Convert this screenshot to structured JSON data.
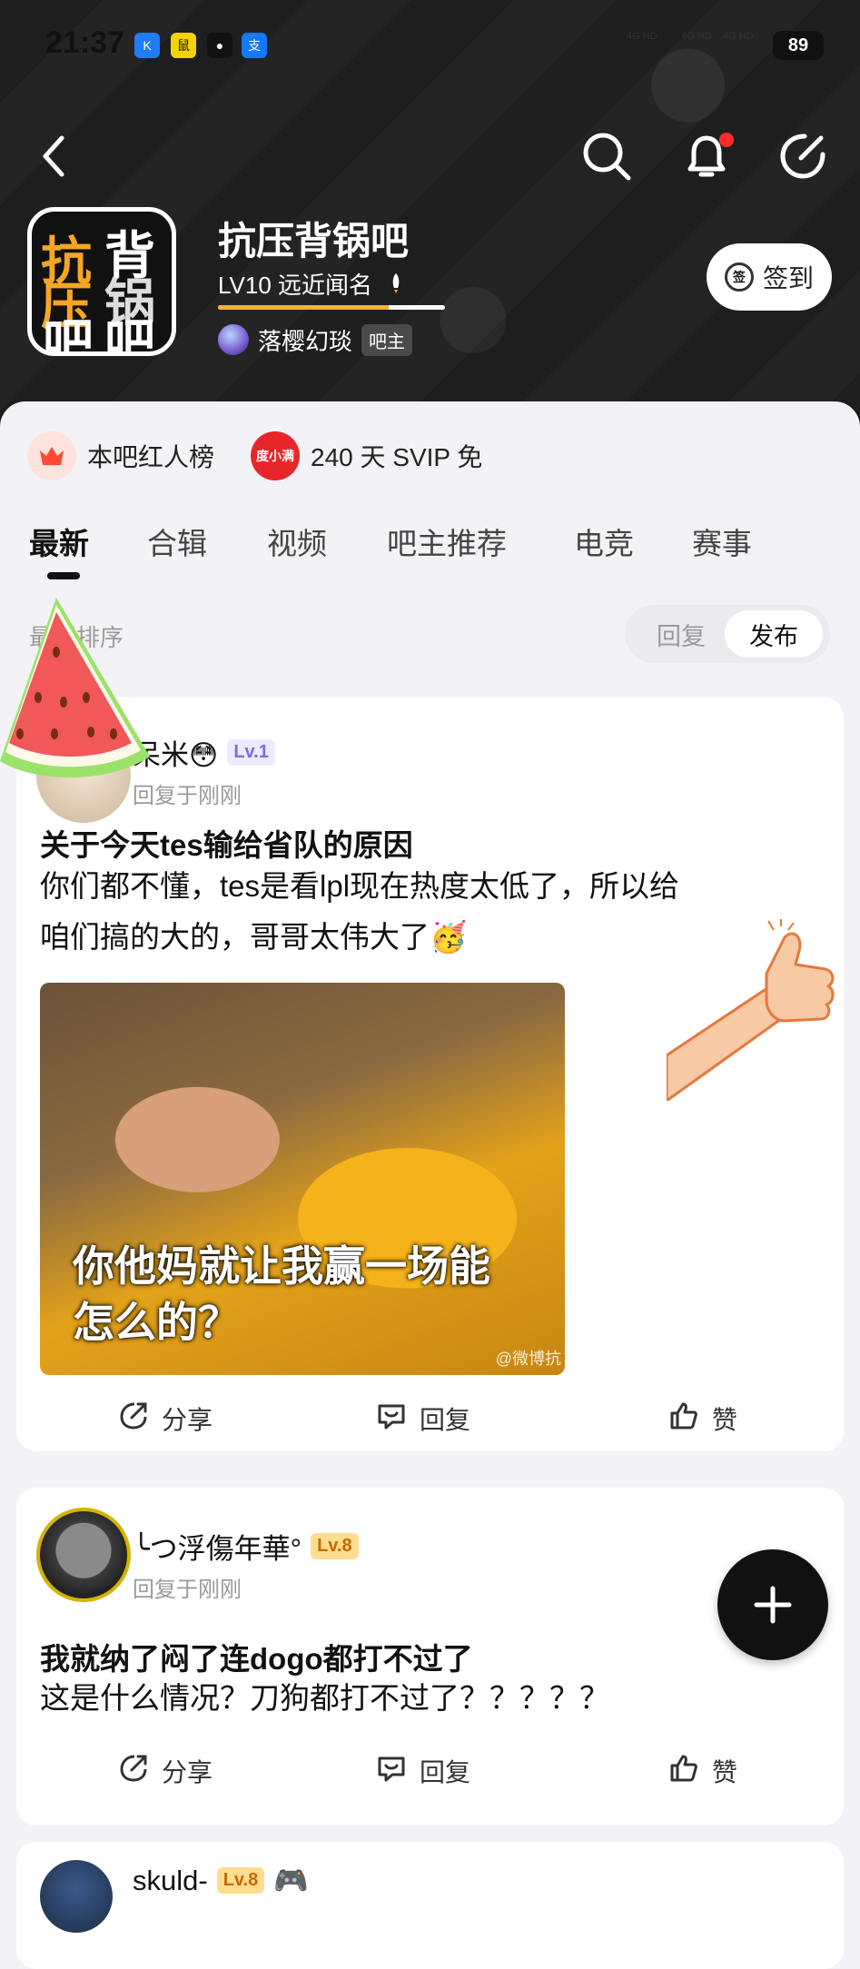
{
  "status_bar": {
    "time": "21:37",
    "apps": [
      "K",
      "鼠",
      "●",
      "支"
    ],
    "battery": "89",
    "signal_text": "4G HD"
  },
  "header": {
    "forum_name": "抗压背锅吧",
    "forum_level": "LV10 远近闻名",
    "level_progress": 0.75,
    "owner_name": "落樱幻琰",
    "owner_badge": "吧主",
    "signin_label": "签到",
    "signin_icon_text": "签",
    "logo_text": [
      "抗",
      "背",
      "压",
      "锅",
      "吧",
      "吧"
    ]
  },
  "quick_links": [
    {
      "label": "本吧红人榜",
      "icon": "crown-icon",
      "color": "#ff4a32"
    },
    {
      "label": "240 天 SVIP 免",
      "icon": "svip-icon",
      "icon_text": "度小满",
      "color": "#e8262a"
    }
  ],
  "tabs": [
    "最新",
    "合辑",
    "视频",
    "吧主推荐",
    "电竞",
    "赛事"
  ],
  "sort": {
    "label": "最新排序",
    "options": [
      "回复",
      "发布"
    ],
    "selected": "发布"
  },
  "posts": [
    {
      "author": "呆米😳",
      "level": "Lv.1",
      "meta": "回复于刚刚",
      "title": "关于今天tes输给省队的原因",
      "body": [
        "你们都不懂，tes是看lpl现在热度太低了，所以给",
        "咱们搞的大的，哥哥太伟大了🥳"
      ],
      "image_caption": [
        "你他妈就让我赢一场能",
        "怎么的？"
      ],
      "image_watermark": "@微博抗",
      "actions": [
        "分享",
        "回复",
        "赞"
      ]
    },
    {
      "author": "╰つ浮傷年華°",
      "level": "Lv.8",
      "meta": "回复于刚刚",
      "title": "我就纳了闷了连dogo都打不过了",
      "body": [
        "这是什么情况？刀狗都打不过了？？？？？"
      ],
      "actions": [
        "分享",
        "回复",
        "赞"
      ]
    },
    {
      "author": "skuld-",
      "level": "Lv.8",
      "emoji": "🎮"
    }
  ]
}
